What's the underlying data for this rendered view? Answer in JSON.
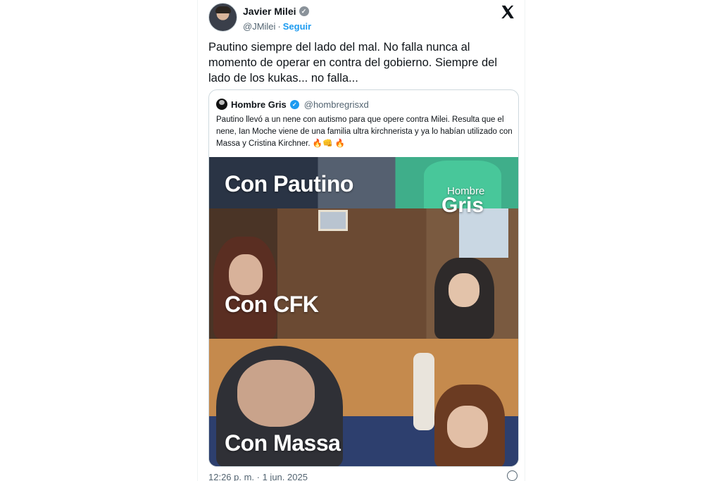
{
  "author": {
    "name": "Javier Milei",
    "handle": "@JMilei",
    "separator": "·",
    "follow_label": "Seguir",
    "verified_color": "#8a929a"
  },
  "tweet_text": "Pautino siempre del lado del mal. No falla nunca al momento de operar en contra del gobierno. Siempre del lado de los kukas... no falla...",
  "quote": {
    "name": "Hombre Gris",
    "handle": "@hombregrisxd",
    "verified_color": "#1d9bf0",
    "text": "Pautino llevó a un nene con autismo para  que opere contra Milei. Resulta que el nene, Ian Moche viene de una familia ultra kirchnerista y ya lo habían utilizado con Massa y Cristina Kirchner.",
    "emojis": "🔥👊 🔥",
    "media": {
      "captions": [
        "Con Pautino",
        "Con CFK",
        "Con Massa"
      ],
      "watermark_top": "Hombre",
      "watermark_bottom": "Gris"
    }
  },
  "footer": {
    "timestamp": "12:26 p. m. · 1 jun. 2025"
  },
  "icons": {
    "close": "x-logo-icon",
    "info": "info-icon"
  },
  "colors": {
    "link": "#1d9bf0",
    "secondary_text": "#536471"
  }
}
